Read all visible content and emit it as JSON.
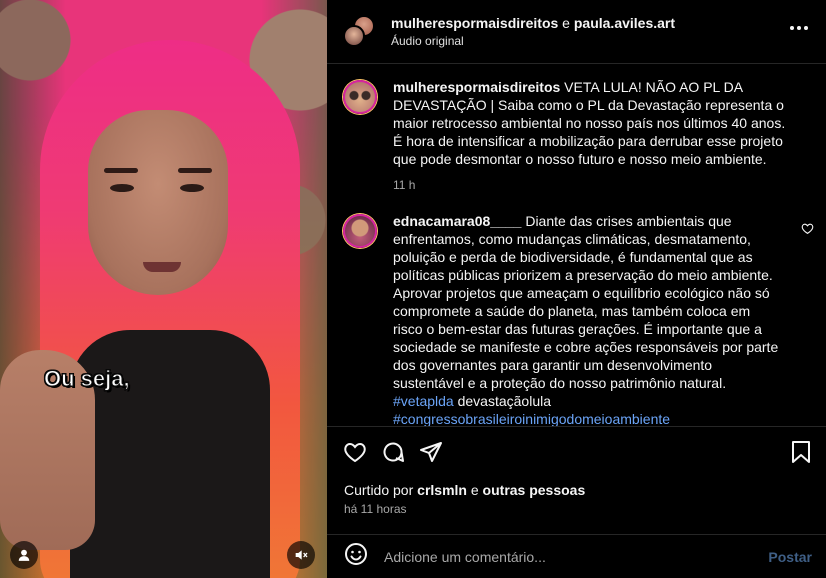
{
  "video": {
    "caption": "Ou seja,",
    "user_icon": "user-icon",
    "mute_icon": "speaker-muted-icon"
  },
  "header": {
    "user1": "mulherespormaisdireitos",
    "conj": "e",
    "user2": "paula.aviles.art",
    "audio": "Áudio original",
    "more_icon": "more-horizontal-icon"
  },
  "caption_post": {
    "user": "mulherespormaisdireitos",
    "text": "VETA LULA! NÃO AO PL DA DEVASTAÇÃO | Saiba como o PL da Devastação representa o maior retrocesso ambiental no nosso país nos últimos 40 anos. É hora de intensificar a mobilização para derrubar esse projeto que pode desmontar o nosso futuro e nosso meio ambiente.",
    "time": "11 h"
  },
  "comment": {
    "user": "ednacamara08____",
    "text": "Diante das crises ambientais que enfrentamos, como mudanças climáticas, desmatamento, poluição e perda de biodiversidade, é fundamental que as políticas públicas priorizem a preservação do meio ambiente. Aprovar projetos que ameaçam o equilíbrio ecológico não só compromete a saúde do planeta, mas também coloca em risco o bem-estar das futuras gerações. É importante que a sociedade se manifeste e cobre ações responsáveis por parte dos governantes para garantir um desenvolvimento sustentável e a proteção do nosso patrimônio natural.",
    "tag1": "#vetaplda",
    "tail": "devastaçãolula",
    "tag2": "#congressobrasileiroinimigodomeioambiente"
  },
  "likes": {
    "prefix": "Curtido por",
    "user": "crlsmln",
    "mid": "e",
    "others": "outras pessoas"
  },
  "ago": "há 11 horas",
  "add_comment": {
    "placeholder": "Adicione um comentário...",
    "post": "Postar"
  },
  "colors": {
    "background": "#000000",
    "text": "#f5f5f5",
    "muted": "#a8a8a8",
    "link": "#6ba4f7",
    "post_disabled": "#3f5f86"
  }
}
